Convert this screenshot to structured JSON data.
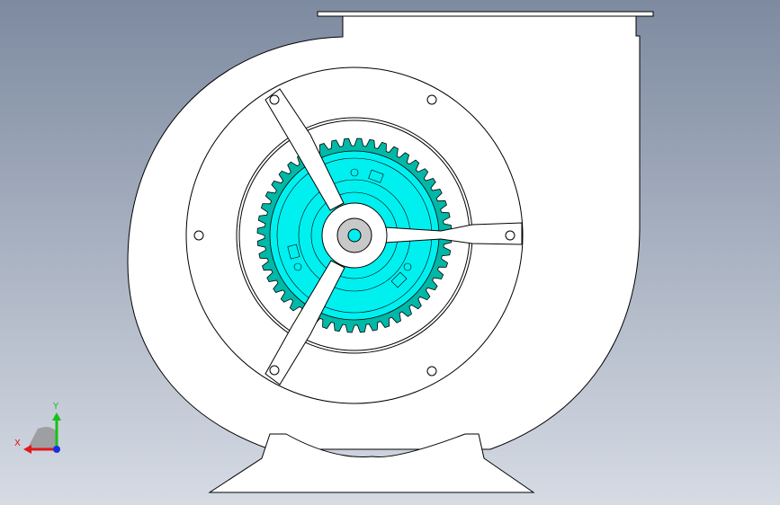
{
  "viewport": {
    "background_top": "#7d8aa0",
    "background_bottom": "#d6dbe4"
  },
  "model": {
    "housing_fill": "#ffffff",
    "line_color": "#000000",
    "impeller_face": "#00f0f0",
    "impeller_rim": "#00b8a8",
    "hub_color": "#c8c8c8",
    "gear_teeth": 48
  },
  "triad": {
    "x_label": "X",
    "y_label": "Y",
    "x_color": "#e01818",
    "y_color": "#18c018",
    "z_color": "#1830e0"
  }
}
